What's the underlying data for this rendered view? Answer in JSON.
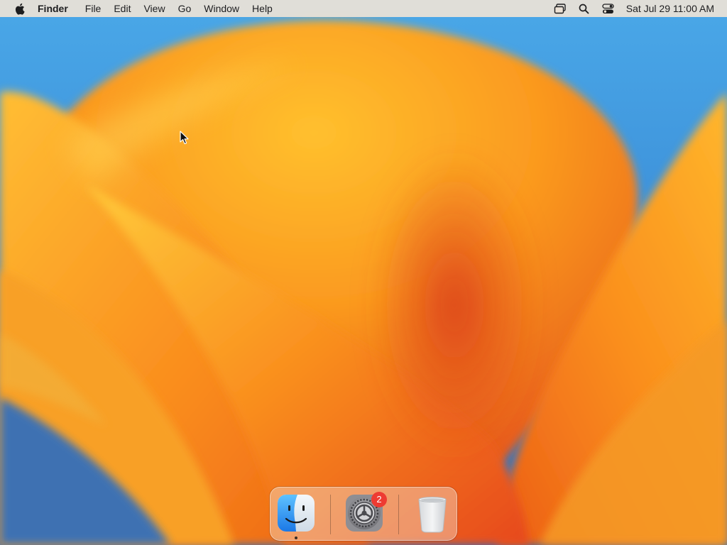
{
  "menubar": {
    "app_name": "Finder",
    "menus": [
      "File",
      "Edit",
      "View",
      "Go",
      "Window",
      "Help"
    ],
    "clock": "Sat Jul 29  11:00 AM",
    "status_icons": [
      "screen-mirroring-icon",
      "spotlight-search-icon",
      "control-center-icon"
    ]
  },
  "dock": {
    "apps": [
      {
        "name": "Finder",
        "icon": "finder-icon",
        "running": true
      },
      {
        "name": "System Settings",
        "icon": "system-settings-icon",
        "badge": "2",
        "running": false
      },
      {
        "name": "Trash",
        "icon": "trash-icon",
        "running": false
      }
    ]
  },
  "colors": {
    "wallpaper_orange": "#f7931e",
    "wallpaper_yellow": "#ffcc3a",
    "wallpaper_red": "#e2451d",
    "wallpaper_blue": "#2f7fd0",
    "badge_red": "#ee3b32"
  }
}
